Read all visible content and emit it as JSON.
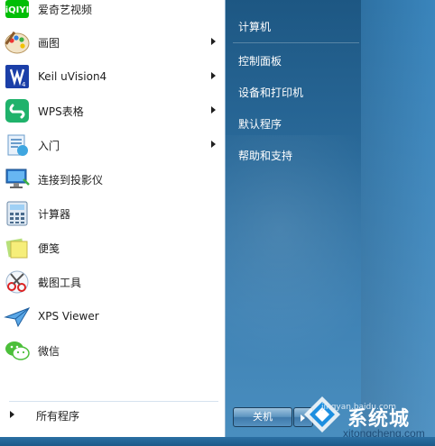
{
  "programs": [
    {
      "label": "爱奇艺视频",
      "icon": "iqiyi-icon",
      "submenu": false
    },
    {
      "label": "画图",
      "icon": "paint-palette-icon",
      "submenu": true
    },
    {
      "label": "Keil uVision4",
      "icon": "keil-icon",
      "submenu": true
    },
    {
      "label": "WPS表格",
      "icon": "wps-spreadsheet-icon",
      "submenu": true
    },
    {
      "label": "入门",
      "icon": "getting-started-icon",
      "submenu": true
    },
    {
      "label": "连接到投影仪",
      "icon": "projector-icon",
      "submenu": false
    },
    {
      "label": "计算器",
      "icon": "calculator-icon",
      "submenu": false
    },
    {
      "label": "便笺",
      "icon": "sticky-notes-icon",
      "submenu": false
    },
    {
      "label": "截图工具",
      "icon": "snipping-tool-icon",
      "submenu": false
    },
    {
      "label": "XPS Viewer",
      "icon": "xps-viewer-icon",
      "submenu": false
    },
    {
      "label": "微信",
      "icon": "wechat-icon",
      "submenu": false
    }
  ],
  "all_programs": "所有程序",
  "right_menu": [
    {
      "label": "计算机"
    },
    {
      "label": "控制面板"
    },
    {
      "label": "设备和打印机"
    },
    {
      "label": "默认程序"
    },
    {
      "label": "帮助和支持"
    }
  ],
  "shutdown_label": "关机",
  "watermark": {
    "brand": "系统城",
    "url": "xitongcheng.com",
    "top_text": "jingyan.baidu.com"
  },
  "colors": {
    "accent_blue": "#2a6a9a",
    "wps_green": "#1fb26b",
    "keil_blue": "#1b3fa8",
    "iqiyi_green": "#00be06",
    "wechat_green": "#4cbf3a"
  }
}
